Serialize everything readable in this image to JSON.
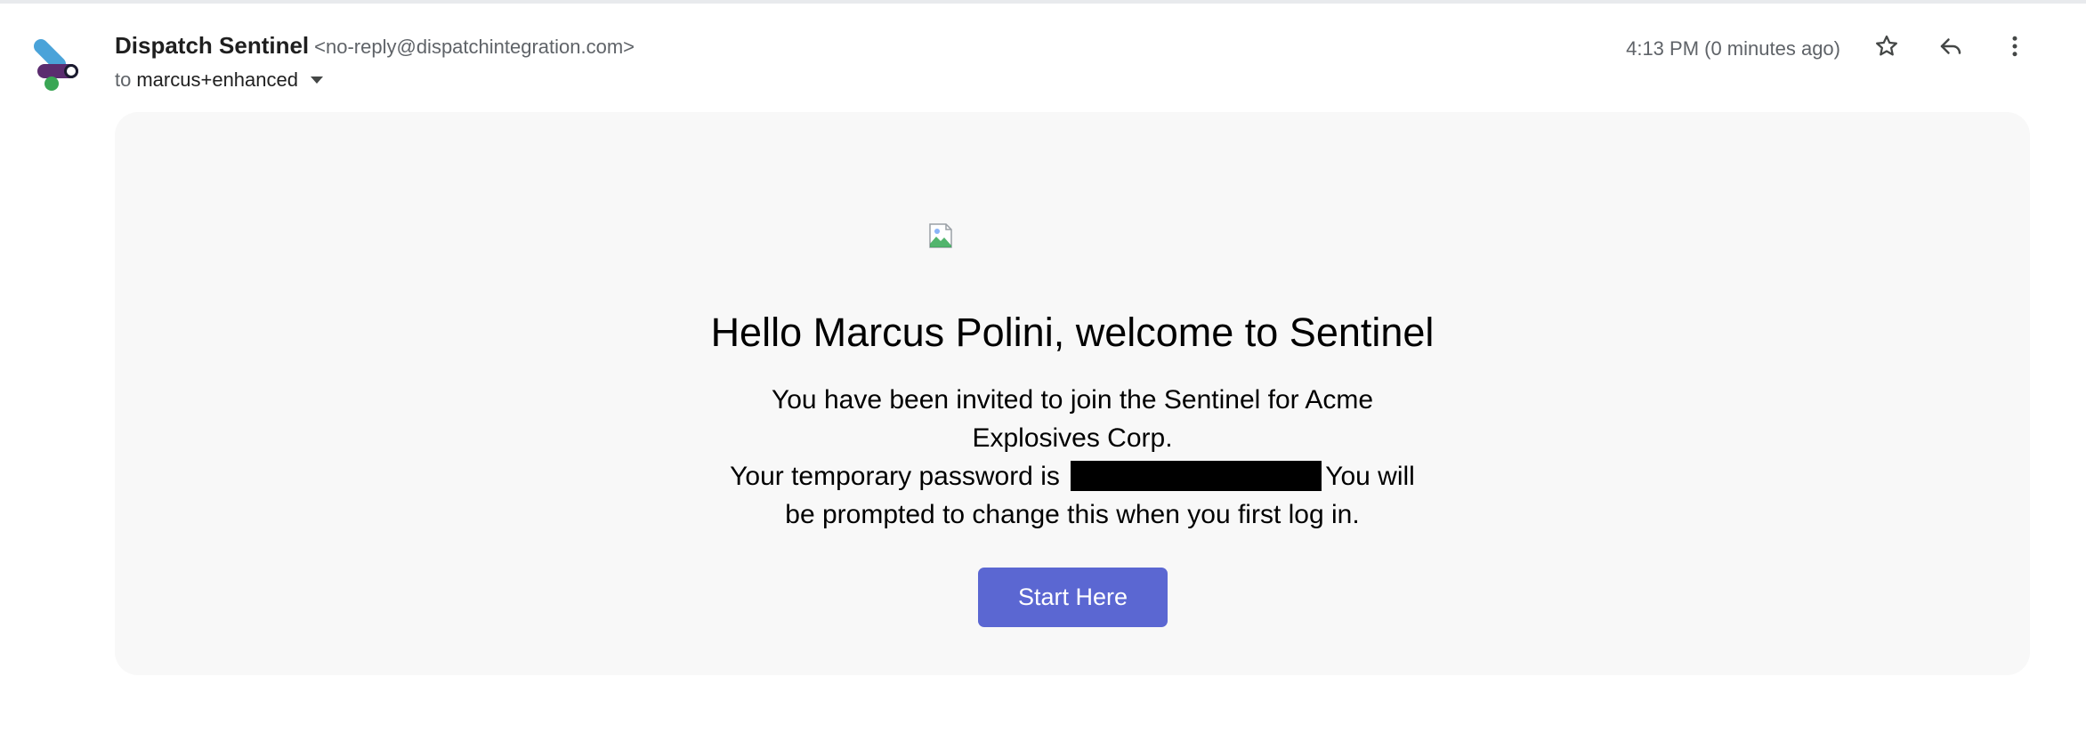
{
  "header": {
    "sender_name": "Dispatch Sentinel",
    "sender_email": "<no-reply@dispatchintegration.com>",
    "to_label": "to",
    "recipient": "marcus+enhanced",
    "timestamp": "4:13 PM (0 minutes ago)",
    "actions": {
      "star_icon": "star-outline-icon",
      "reply_icon": "reply-icon",
      "more_icon": "more-vertical-icon"
    }
  },
  "email": {
    "headline": "Hello Marcus Polini, welcome to Sentinel",
    "invite_line_1": "You have been invited to join the Sentinel for Acme",
    "invite_line_2": "Explosives Corp.",
    "password_prefix": "Your temporary password is",
    "password_suffix": "You will",
    "prompt_line": "be prompted to change this when you first log in.",
    "button_label": "Start Here",
    "button_color": "#5b67d2"
  },
  "colors": {
    "card_background": "#f8f8f8",
    "muted_text": "#5f6368"
  }
}
